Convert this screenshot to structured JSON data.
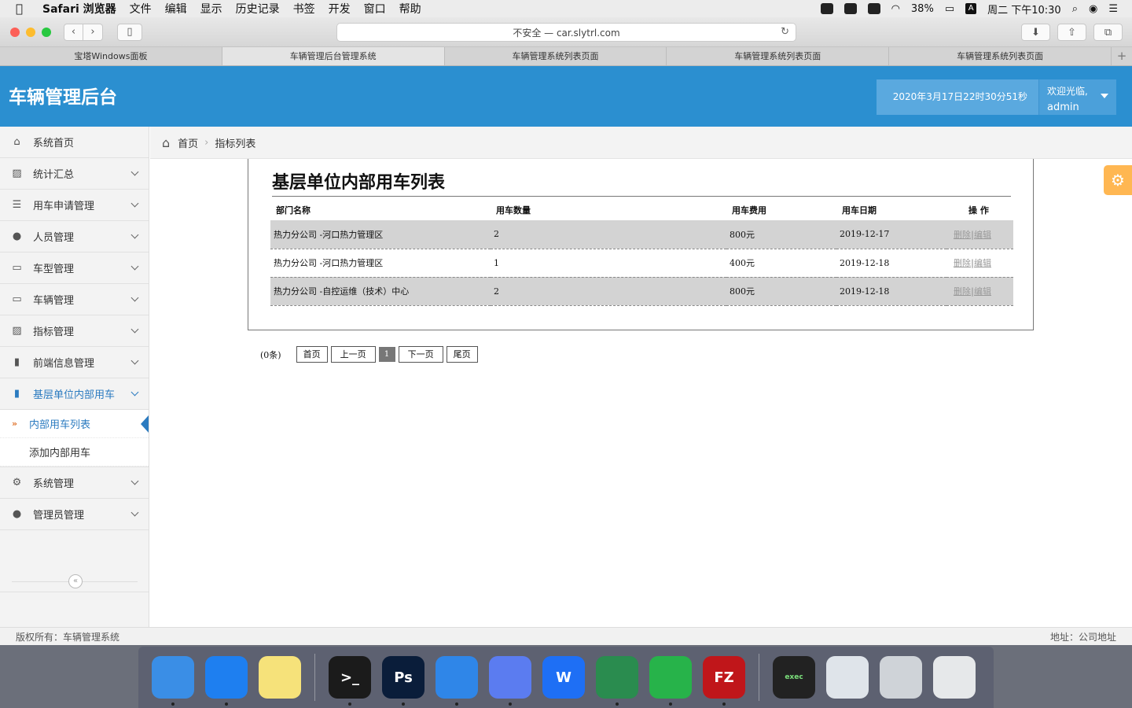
{
  "menubar": {
    "app_name": "Safari 浏览器",
    "items": [
      "文件",
      "编辑",
      "显示",
      "历史记录",
      "书签",
      "开发",
      "窗口",
      "帮助"
    ],
    "battery": "38%",
    "input_badge": "A",
    "clock": "周二 下午10:30"
  },
  "browser": {
    "address": "不安全 — car.slytrl.com",
    "tabs": [
      {
        "label": "宝塔Windows面板",
        "active": false
      },
      {
        "label": "车辆管理后台管理系统",
        "active": true
      },
      {
        "label": "车辆管理系统列表页面",
        "active": false
      },
      {
        "label": "车辆管理系统列表页面",
        "active": false
      },
      {
        "label": "车辆管理系统列表页面",
        "active": false
      }
    ],
    "new_tab": "+"
  },
  "header": {
    "title": "车辆管理后台",
    "datetime": "2020年3月17日22时30分51秒",
    "welcome": "欢迎光临,",
    "user": "admin"
  },
  "sidebar": {
    "items": [
      {
        "label": "系统首页",
        "icon": "home-icon",
        "icon_glyph": "⌂"
      },
      {
        "label": "统计汇总",
        "icon": "picture-icon",
        "icon_glyph": "▨"
      },
      {
        "label": "用车申请管理",
        "icon": "list-icon",
        "icon_glyph": "☰"
      },
      {
        "label": "人员管理",
        "icon": "user-icon",
        "icon_glyph": "●"
      },
      {
        "label": "车型管理",
        "icon": "laptop-icon",
        "icon_glyph": "▭"
      },
      {
        "label": "车辆管理",
        "icon": "laptop-icon",
        "icon_glyph": "▭"
      },
      {
        "label": "指标管理",
        "icon": "picture-icon",
        "icon_glyph": "▨"
      },
      {
        "label": "前端信息管理",
        "icon": "bookmark-icon",
        "icon_glyph": "▮"
      },
      {
        "label": "基层单位内部用车",
        "icon": "bookmark-icon",
        "icon_glyph": "▮"
      }
    ],
    "subitems": [
      {
        "label": "内部用车列表",
        "current": true
      },
      {
        "label": "添加内部用车",
        "current": false
      }
    ],
    "items_after": [
      {
        "label": "系统管理",
        "icon": "cogs-icon",
        "icon_glyph": "⚙"
      },
      {
        "label": "管理员管理",
        "icon": "users-icon",
        "icon_glyph": "●"
      }
    ],
    "collapse_glyph": "«"
  },
  "breadcrumb": {
    "home": "首页",
    "current": "指标列表",
    "separator": "›"
  },
  "main": {
    "title": "基层单位内部用车列表",
    "columns": [
      "部门名称",
      "用车数量",
      "用车费用",
      "用车日期",
      "操 作"
    ],
    "rows": [
      {
        "dept": "热力分公司 -河口热力管理区",
        "qty": "2",
        "cost": "800元",
        "date": "2019-12-17"
      },
      {
        "dept": "热力分公司 -河口热力管理区",
        "qty": "1",
        "cost": "400元",
        "date": "2019-12-18"
      },
      {
        "dept": "热力分公司 -自控运维（技术）中心",
        "qty": "2",
        "cost": "800元",
        "date": "2019-12-18"
      }
    ],
    "op_delete": "删除",
    "op_sep": "|",
    "op_edit": "编辑"
  },
  "pager": {
    "count": "(0条)",
    "first": "首页",
    "prev": "上一页",
    "page": "1",
    "next": "下一页",
    "last": "尾页"
  },
  "footer": {
    "copyright": "版权所有：车辆管理系统",
    "address": "地址：公司地址"
  },
  "colors": {
    "header_bg": "#2b8fd0",
    "accent": "#2b7bc0",
    "settings_button": "#ffb752"
  },
  "dock": [
    {
      "name": "finder-icon",
      "bg": "#3a8ee6",
      "label": ""
    },
    {
      "name": "safari-icon",
      "bg": "#1e7ff0",
      "label": ""
    },
    {
      "name": "notes-icon",
      "bg": "#f6e27a",
      "label": ""
    },
    {
      "name": "terminal-icon",
      "bg": "#1b1b1b",
      "label": ">_"
    },
    {
      "name": "photoshop-icon",
      "bg": "#0a1d3a",
      "label": "Ps"
    },
    {
      "name": "xcode-icon",
      "bg": "#2f86e8",
      "label": ""
    },
    {
      "name": "lark-icon",
      "bg": "#5b7cf0",
      "label": ""
    },
    {
      "name": "wps-icon",
      "bg": "#1e6ff5",
      "label": "W"
    },
    {
      "name": "android-studio-icon",
      "bg": "#2a8c4f",
      "label": ""
    },
    {
      "name": "wechat-icon",
      "bg": "#27b34a",
      "label": ""
    },
    {
      "name": "filezilla-icon",
      "bg": "#c0161a",
      "label": "FZ"
    },
    {
      "name": "exec-icon",
      "bg": "#222222",
      "label": "exec"
    },
    {
      "name": "window-thumb-icon",
      "bg": "#dfe4ea",
      "label": ""
    },
    {
      "name": "window-thumb-icon",
      "bg": "#cfd3d8",
      "label": ""
    },
    {
      "name": "trash-icon",
      "bg": "#e6e8ea",
      "label": ""
    }
  ]
}
